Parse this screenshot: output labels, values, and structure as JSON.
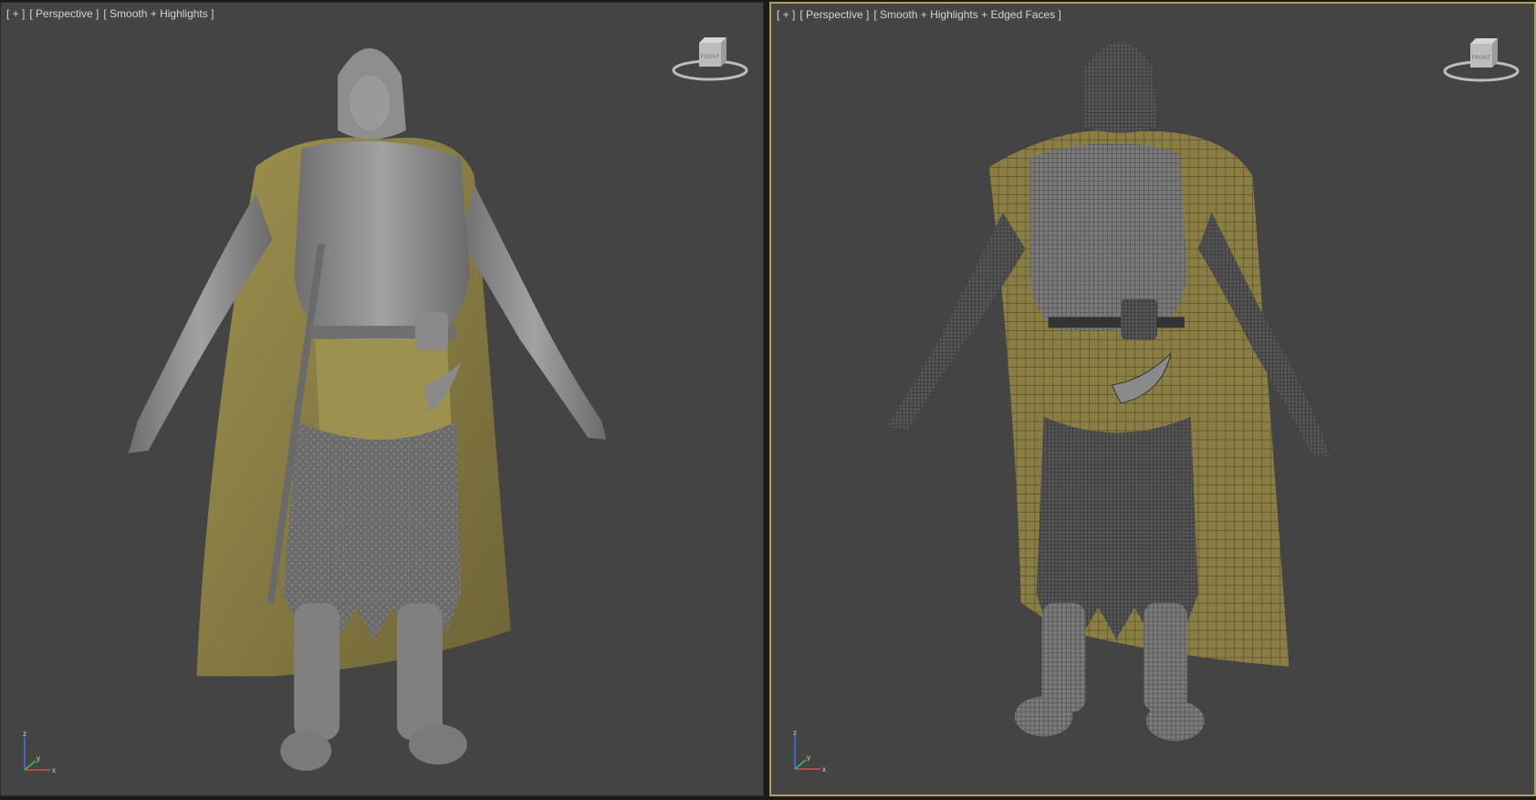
{
  "viewports": [
    {
      "labels": [
        "[ + ]",
        "[ Perspective ]",
        "[ Smooth + Highlights ]"
      ],
      "shading": "smooth-highlights",
      "active": false
    },
    {
      "labels": [
        "[ + ]",
        "[ Perspective ]",
        "[ Smooth + Highlights + Edged Faces ]"
      ],
      "shading": "smooth-highlights-edged-faces",
      "active": true
    }
  ],
  "viewcube": {
    "face_label": "FRONT"
  },
  "axis_gizmo": {
    "x": "x",
    "y": "y",
    "z": "z"
  },
  "colors": {
    "viewport_bg": "#444444",
    "active_border": "#b0a060",
    "armor": "#8c8c8c",
    "cloak": "#8a7e45",
    "mail": "#7a7a7a"
  }
}
